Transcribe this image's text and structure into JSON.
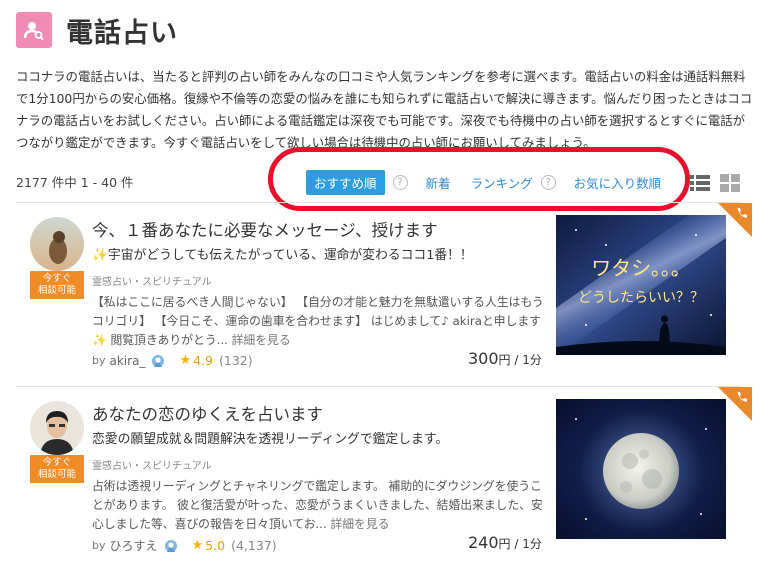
{
  "header": {
    "title": "電話占い",
    "icon": "person-search-icon"
  },
  "intro": "ココナラの電話占いは、当たると評判の占い師をみんなの口コミや人気ランキングを参考に選べます。電話占いの料金は通話料無料で1分100円からの安心価格。復縁や不倫等の恋愛の悩みを誰にも知られずに電話占いで解決に導きます。悩んだり困ったときはココナラの電話占いをお試しください。占い師による電話鑑定は深夜でも可能です。深夜でも待機中の占い師を選択するとすぐに電話がつながり鑑定ができます。今すぐ電話占いをして欲しい場合は待機中の占い師にお願いしてみましょう。",
  "results_count": "2177 件中 1 - 40 件",
  "sort": {
    "recommended": "おすすめ順",
    "new": "新着",
    "ranking": "ランキング",
    "favorites": "お気に入り数順",
    "help": "?"
  },
  "colors": {
    "accent": "#2e9ce0",
    "badge": "#f08c28",
    "highlight": "#e8102a",
    "header_icon": "#f08cb4",
    "star": "#f3b400"
  },
  "listings": [
    {
      "title": "今、１番あなたに必要なメッセージ、授けます",
      "subtitle": "✨宇宙がどうしても伝えたがっている、運命が変わるココ1番！！",
      "badge_line1": "今すぐ",
      "badge_line2": "相談可能",
      "category": "霊感占い・スピリチュアル",
      "description": "【私はここに居るべき人間じゃない】 【自分の才能と魅力を無駄遣いする人生はもうコリゴリ】 【今日こそ、運命の歯車を合わせます】 はじめまして♪ akiraと申します✨ 閲覧頂きありがとう...",
      "more": "詳細を見る",
      "by": "by",
      "seller": "akira_",
      "rating": "4.9",
      "reviews": "(132)",
      "price": "300",
      "price_unit": "円 / 1分",
      "thumb_text_line1": "ワタシ。。。",
      "thumb_text_line2": "どうしたらいい？？"
    },
    {
      "title": "あなたの恋のゆくえを占います",
      "subtitle": "恋愛の願望成就＆問題解決を透視リーディングで鑑定します。",
      "badge_line1": "今すぐ",
      "badge_line2": "相談可能",
      "category": "霊感占い・スピリチュアル",
      "description": "占術は透視リーディングとチャネリングで鑑定します。 補助的にダウジングを使うことがあります。 彼と復活愛が叶った、恋愛がうまくいきました、結婚出来ました、安心しました等、喜びの報告を日々頂いてお...",
      "more": "詳細を見る",
      "by": "by",
      "seller": "ひろすえ",
      "rating": "5.0",
      "reviews": "(4,137)",
      "price": "240",
      "price_unit": "円 / 1分"
    }
  ]
}
